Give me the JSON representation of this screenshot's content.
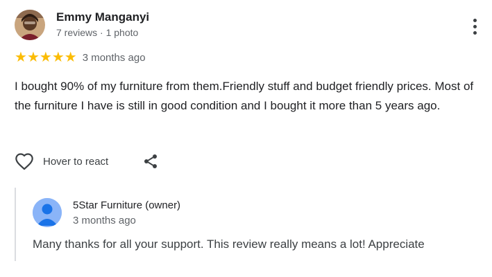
{
  "reviewer": {
    "name": "Emmy Manganyi",
    "meta": "7 reviews · 1 photo"
  },
  "rating": {
    "stars": 5,
    "max": 5,
    "date": "3 months ago",
    "star_color": "#fbbc04"
  },
  "review": {
    "text": "I bought 90% of my furniture from them.Friendly stuff and budget friendly prices. Most of the furniture I have is still in good condition and I bought it more than 5 years ago."
  },
  "actions": {
    "react_label": "Hover to react",
    "react_icon": "heart-outline-icon",
    "share_icon": "share-icon",
    "more_icon": "more-vert-icon"
  },
  "owner_reply": {
    "name": "5Star Furniture (owner)",
    "date": "3 months ago",
    "text": "Many thanks for all your support. This review really means a lot! Appreciate",
    "avatar_color": "#8ab4f8"
  }
}
